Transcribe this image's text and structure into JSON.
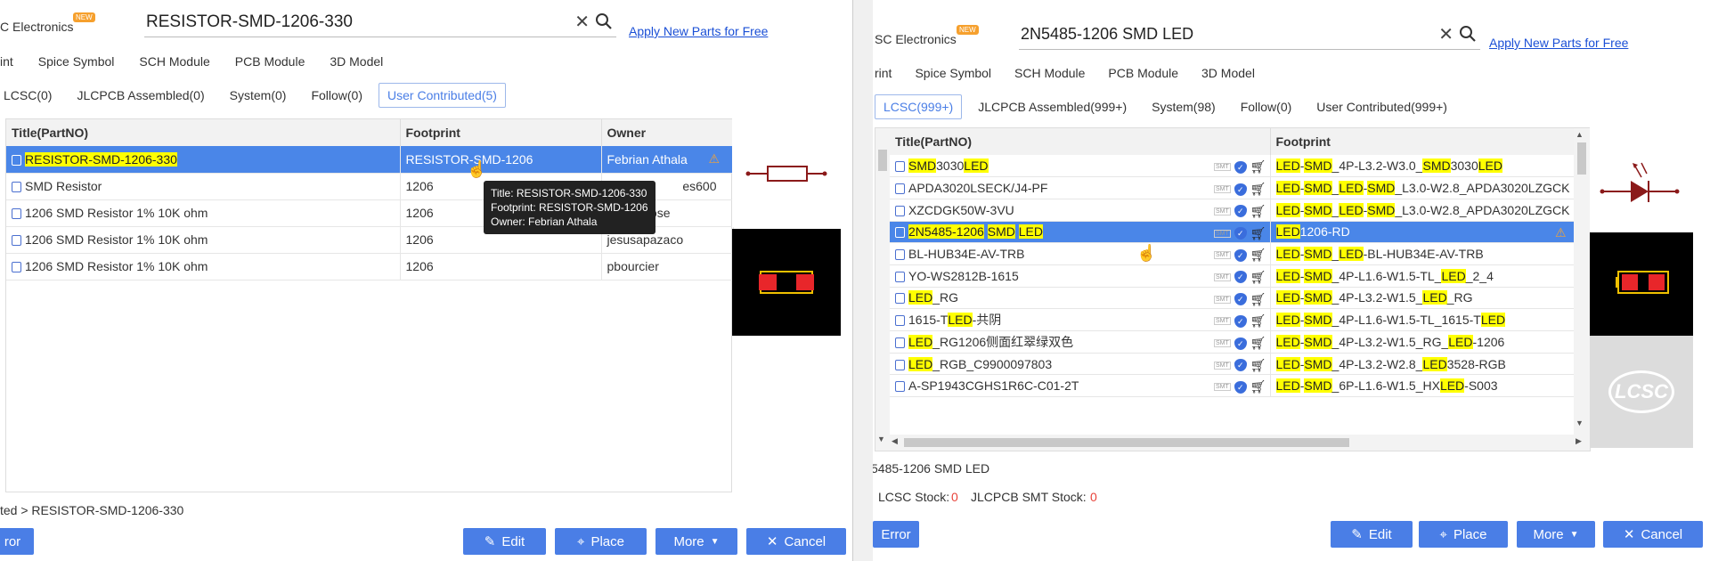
{
  "left": {
    "brand": "C Electronics",
    "new_badge": "NEW",
    "search_value": "RESISTOR-SMD-1206-330",
    "apply_link": "Apply New Parts for Free",
    "tabs_top": [
      "int",
      "Spice Symbol",
      "SCH Module",
      "PCB Module",
      "3D Model"
    ],
    "tabs_lib": [
      "LCSC(0)",
      "JLCPCB Assembled(0)",
      "System(0)",
      "Follow(0)",
      "User Contributed(5)"
    ],
    "active_lib_tab": 4,
    "columns": [
      "Title(PartNO)",
      "Footprint",
      "Owner"
    ],
    "rows": [
      {
        "title": "RESISTOR-SMD-1206-330",
        "footprint": "RESISTOR-SMD-1206",
        "owner": "Febrian Athala",
        "selected": true
      },
      {
        "title": "SMD Resistor",
        "footprint": "1206",
        "owner": "es600"
      },
      {
        "title": "1206 SMD Resistor 1% 10K ohm",
        "footprint": "1206",
        "owner": "ose"
      },
      {
        "title": "1206 SMD Resistor 1% 10K ohm",
        "footprint": "1206",
        "owner": "jesusapazaco"
      },
      {
        "title": "1206 SMD Resistor 1% 10K ohm",
        "footprint": "1206",
        "owner": "pbourcier"
      }
    ],
    "tooltip": {
      "line1": "Title: RESISTOR-SMD-1206-330",
      "line2": "Footprint: RESISTOR-SMD-1206",
      "line3": "Owner: Febrian Athala"
    },
    "breadcrumb": "ted > RESISTOR-SMD-1206-330",
    "error_btn": "ror",
    "edit_btn": "Edit",
    "place_btn": "Place",
    "more_btn": "More",
    "cancel_btn": "Cancel"
  },
  "right": {
    "brand": "SC Electronics",
    "new_badge": "NEW",
    "search_value": "2N5485-1206 SMD LED",
    "apply_link": "Apply New Parts for Free",
    "tabs_top": [
      "rint",
      "Spice Symbol",
      "SCH Module",
      "PCB Module",
      "3D Model"
    ],
    "tabs_lib": [
      "LCSC(999+)",
      "JLCPCB Assembled(999+)",
      "System(98)",
      "Follow(0)",
      "User Contributed(999+)"
    ],
    "active_lib_tab": 0,
    "columns": [
      "Title(PartNO)",
      "Footprint"
    ],
    "smt_label": "SMT",
    "rows": [
      {
        "title": "SMD3030LED",
        "footprint": "LED-SMD_4P-L3.2-W3.0_SMD3030LED"
      },
      {
        "title": "APDA3020LSECK/J4-PF",
        "footprint": "LED-SMD_LED-SMD_L3.0-W2.8_APDA3020LZGCK"
      },
      {
        "title": "XZCDGK50W-3VU",
        "footprint": "LED-SMD_LED-SMD_L3.0-W2.8_APDA3020LZGCK"
      },
      {
        "title": "2N5485-1206 SMD LED",
        "footprint": "LED1206-RD",
        "selected": true
      },
      {
        "title": "BL-HUB34E-AV-TRB",
        "footprint": "LED-SMD_LED-BL-HUB34E-AV-TRB"
      },
      {
        "title": "YO-WS2812B-1615",
        "footprint": "LED-SMD_4P-L1.6-W1.5-TL_LED_2_4"
      },
      {
        "title": "LED_RG",
        "footprint": "LED-SMD_4P-L3.2-W1.5_LED_RG"
      },
      {
        "title": "1615-TLED-共阴",
        "footprint": "LED-SMD_4P-L1.6-W1.5-TL_1615-TLED"
      },
      {
        "title": "LED_RG1206侧面红翠绿双色",
        "footprint": "LED-SMD_4P-L3.2-W1.5_RG_LED-1206"
      },
      {
        "title": "LED_RGB_C9900097803",
        "footprint": "LED-SMD_4P-L3.2-W2.8_LED3528-RGB"
      },
      {
        "title": "A-SP1943CGHS1R6C-C01-2T",
        "footprint": "LED-SMD_6P-L1.6-W1.5_HXLED-S003"
      }
    ],
    "selected_part": "5485-1206 SMD LED",
    "lcsc_stock_label": "LCSC Stock:",
    "lcsc_stock_value": "0",
    "jlc_stock_label": "JLCPCB SMT Stock:",
    "jlc_stock_value": "0",
    "lcsc_watermark": "LCSC",
    "error_btn": "Error",
    "edit_btn": "Edit",
    "place_btn": "Place",
    "more_btn": "More",
    "cancel_btn": "Cancel"
  }
}
